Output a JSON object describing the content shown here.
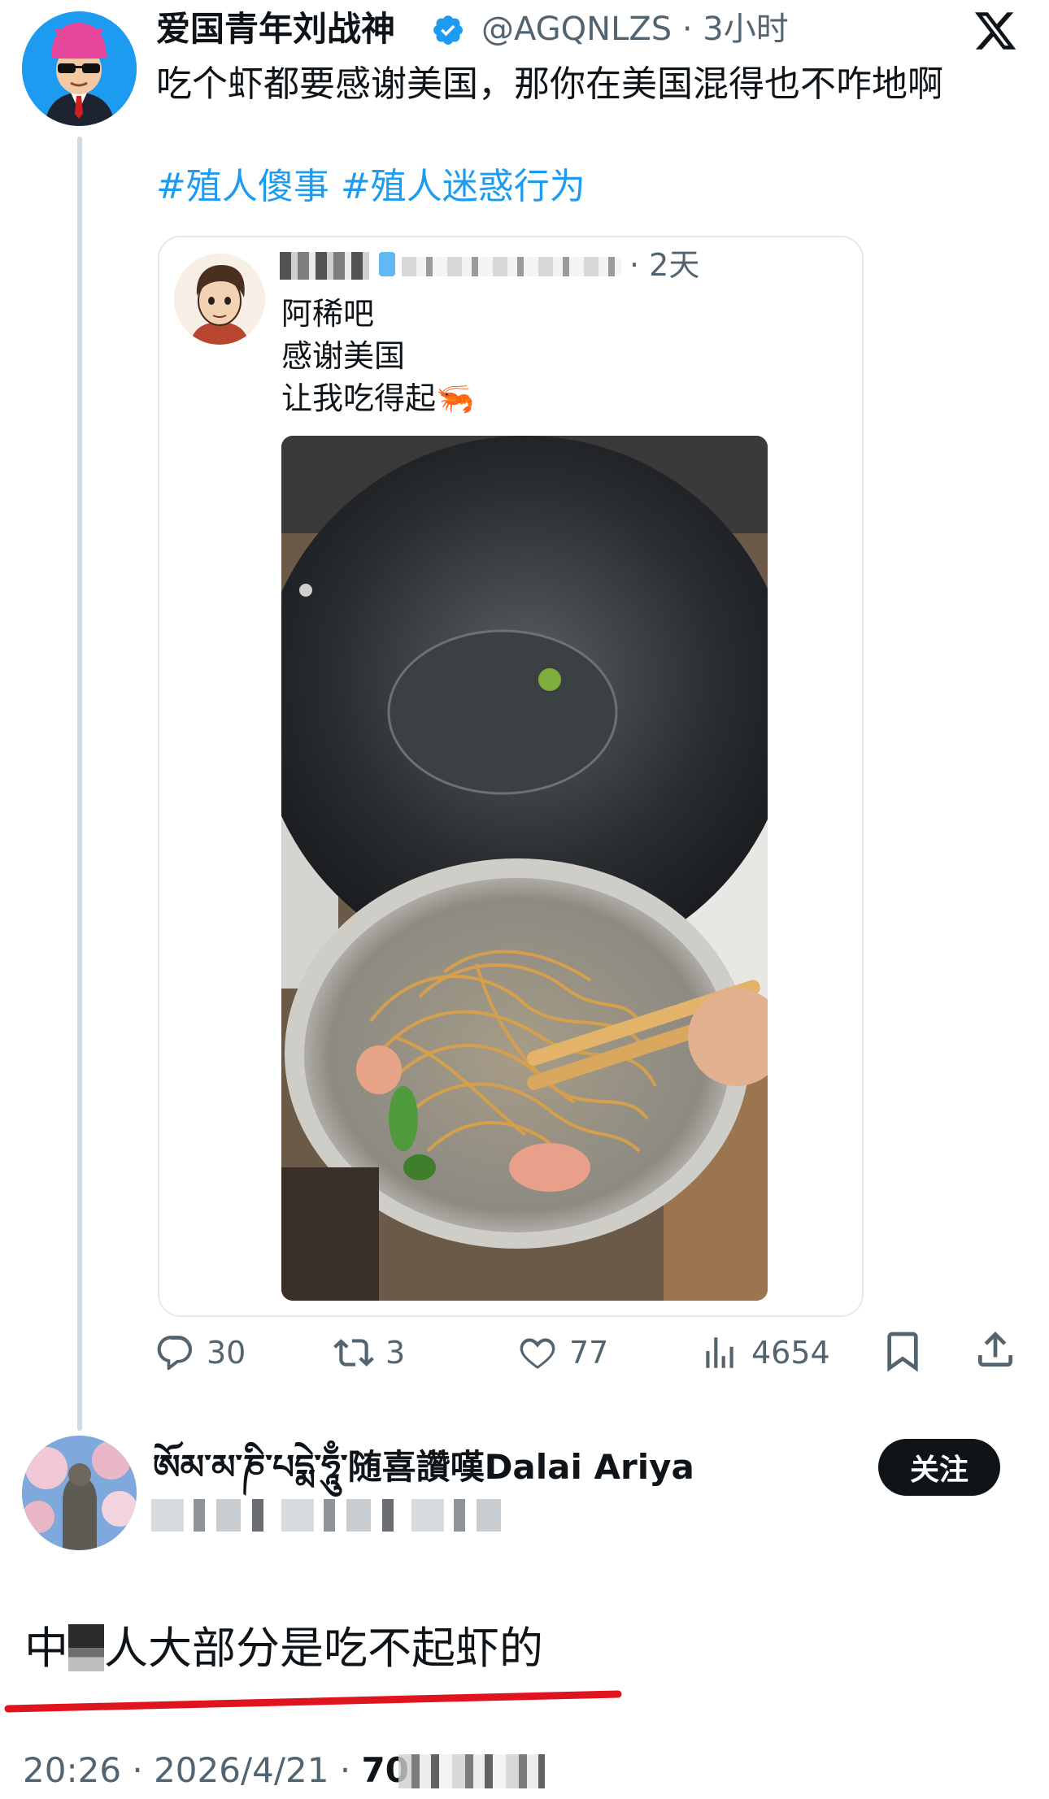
{
  "main_post": {
    "display_name": "爱国青年刘战神",
    "handle_time": "@AGQNLZS · 3小时",
    "text": "吃个虾都要感谢美国，那你在美国混得也不咋地啊",
    "hashtags": "#殖人傻事 #殖人迷惑行为"
  },
  "quoted_post": {
    "meta_time": "· 2天",
    "lines": [
      "阿稀吧",
      "感谢美国",
      "让我吃得起🦐"
    ]
  },
  "actions": {
    "replies": "30",
    "reposts": "3",
    "likes": "77",
    "views": "4654"
  },
  "reply_post": {
    "display_name": "ཨོམ་མ་ཎི་པདྨེ་ཧཱུྃ་随喜讚嘆Dalai Ariya",
    "follow_label": "关注",
    "text_before": "中",
    "text_after": "人大部分是吃不起虾的",
    "footer_time": "20:26 · 2026/4/21 · ",
    "footer_count": "70"
  },
  "colors": {
    "accent": "#1d9bf0",
    "text": "#0f1419",
    "muted": "#536471",
    "highlight_underline": "#e0141e"
  },
  "icons": [
    "x-logo-icon",
    "verified-badge-icon",
    "reply-icon",
    "repost-icon",
    "like-icon",
    "views-icon",
    "bookmark-icon",
    "share-icon"
  ]
}
